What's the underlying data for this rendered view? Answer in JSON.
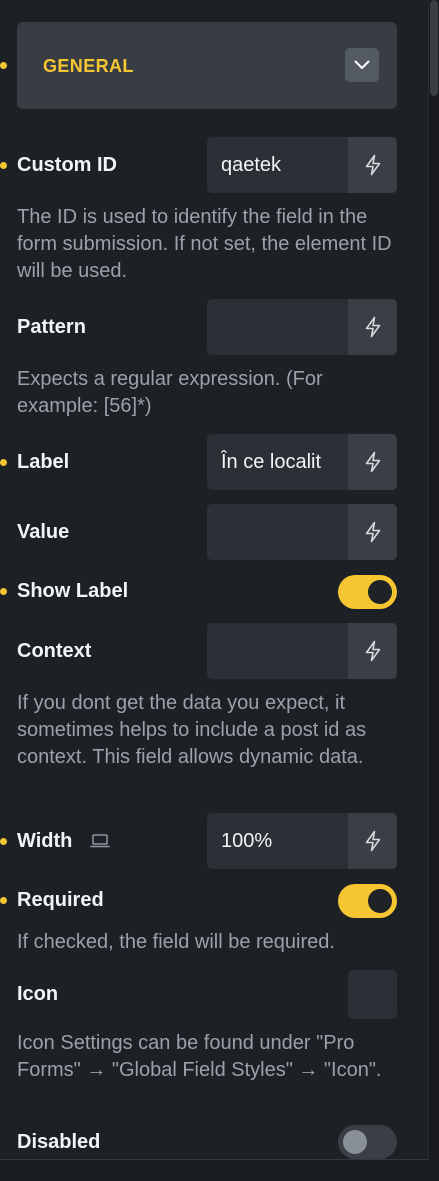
{
  "group": {
    "title": "GENERAL",
    "icon": "chevron-down-icon"
  },
  "fields": {
    "custom_id": {
      "label": "Custom ID",
      "value": "qaetek",
      "description": "The ID is used to identify the field in the form submission. If not set, the element ID will be used."
    },
    "pattern": {
      "label": "Pattern",
      "value": "",
      "description": "Expects a regular expression. (For example: [56]*)"
    },
    "label": {
      "label": "Label",
      "value": "În ce localit"
    },
    "value": {
      "label": "Value",
      "value": ""
    },
    "show_label": {
      "label": "Show Label",
      "checked": true
    },
    "context": {
      "label": "Context",
      "value": "",
      "description": "If you dont get the data you expect, it sometimes helps to include a post id as context. This field allows dynamic data."
    },
    "width": {
      "label": "Width",
      "value": "100%",
      "icon": "laptop-icon"
    },
    "required": {
      "label": "Required",
      "checked": true,
      "description": "If checked, the field will be required."
    },
    "icon": {
      "label": "Icon",
      "description": "Icon Settings can be found under \"Pro Forms\" → \"Global Field Styles\" → \"Icon\"."
    },
    "disabled": {
      "label": "Disabled",
      "checked": false
    }
  },
  "dynamic_data_icon": "bolt-icon",
  "colors": {
    "accent": "#f6c532",
    "background": "#1d2024",
    "input": "#2c3036"
  }
}
